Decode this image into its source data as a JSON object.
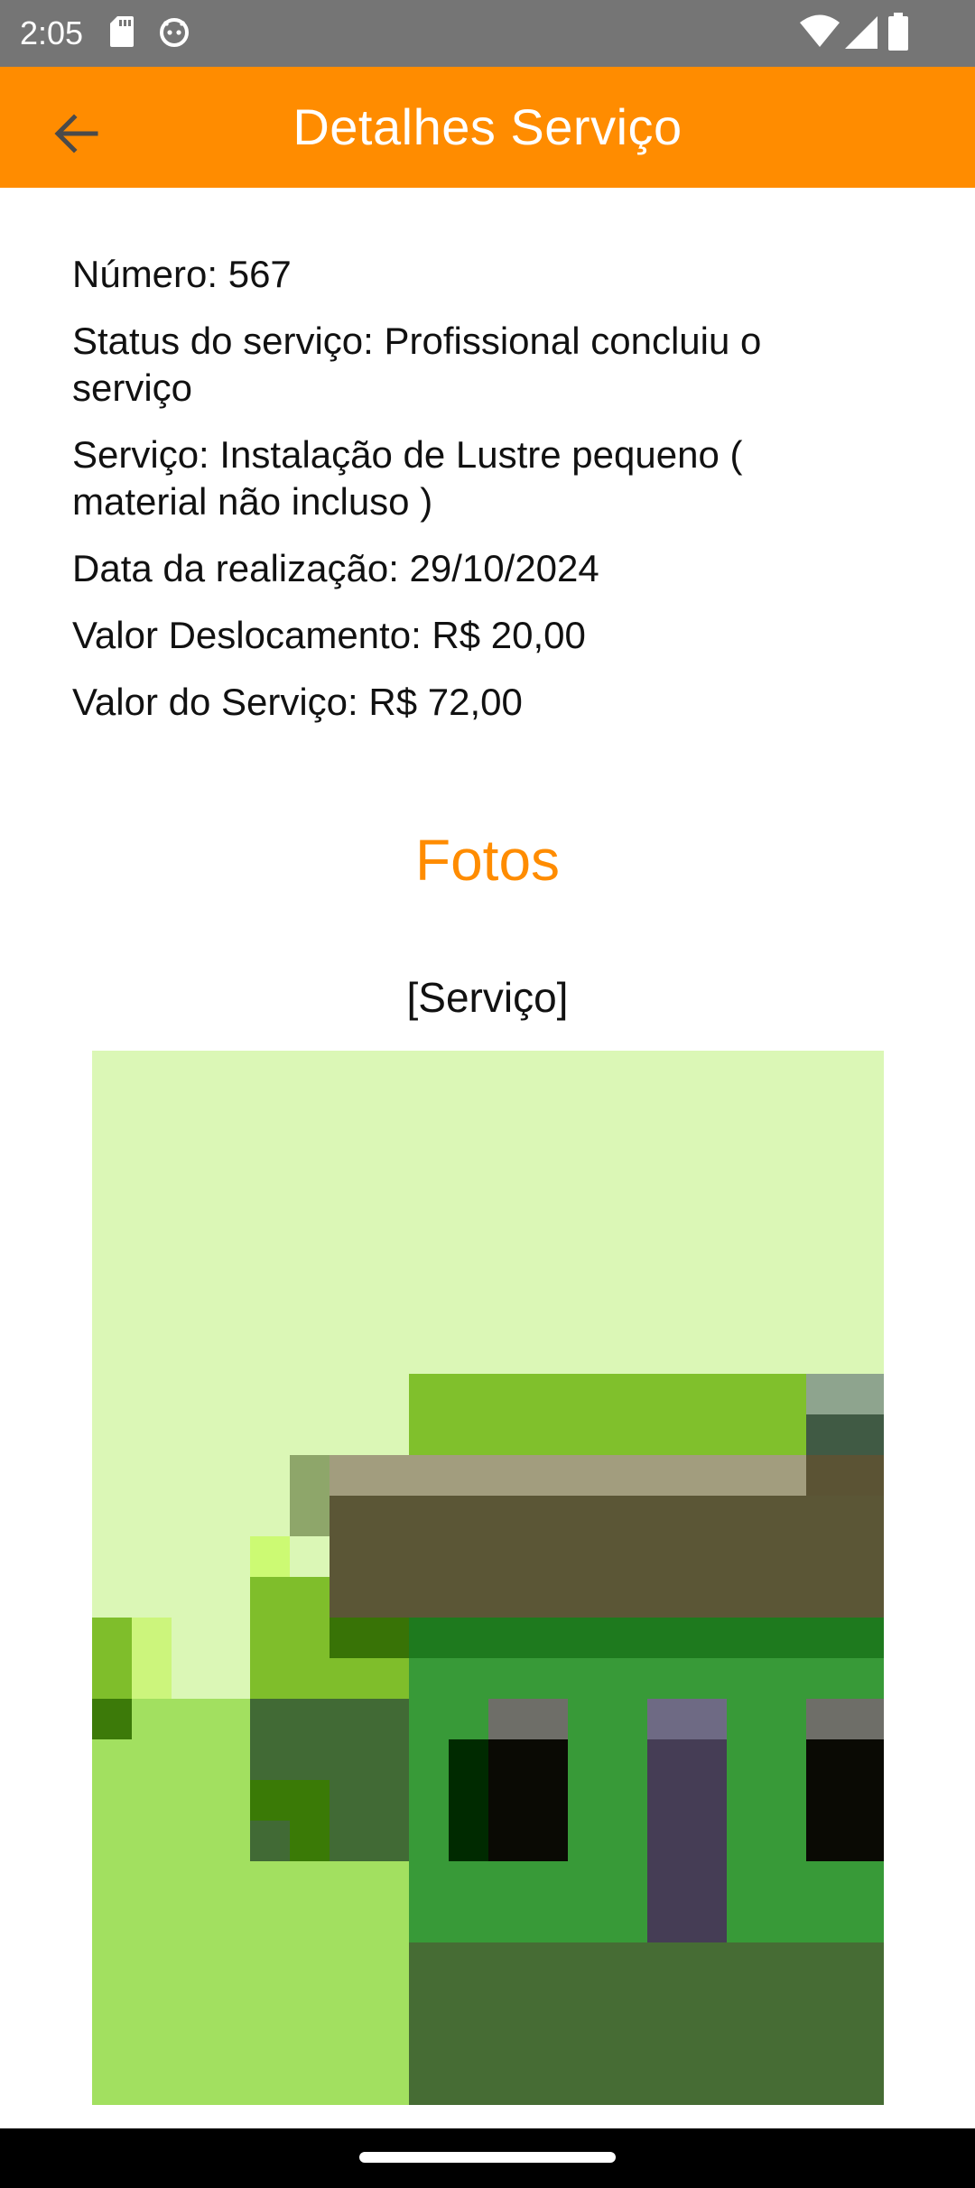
{
  "status_bar": {
    "time": "2:05"
  },
  "app_bar": {
    "title": "Detalhes Serviço"
  },
  "details": {
    "numero": "Número: 567",
    "status": "Status do serviço: Profissional concluiu o serviço",
    "servico": "Serviço: Instalação de Lustre pequeno ( material não incluso )",
    "data": "Data da realização: 29/10/2024",
    "valor_deslocamento": "Valor Deslocamento: R$ 20,00",
    "valor_servico": "Valor do Serviço: R$ 72,00"
  },
  "photos": {
    "section_title": "Fotos",
    "label": "[Serviço]"
  },
  "colors": {
    "accent": "#ff8c00",
    "status_bar": "#757575"
  },
  "icons": [
    "sd-card-icon",
    "android-debug-icon",
    "wifi-icon",
    "cellular-icon",
    "battery-icon",
    "back-arrow-icon"
  ]
}
